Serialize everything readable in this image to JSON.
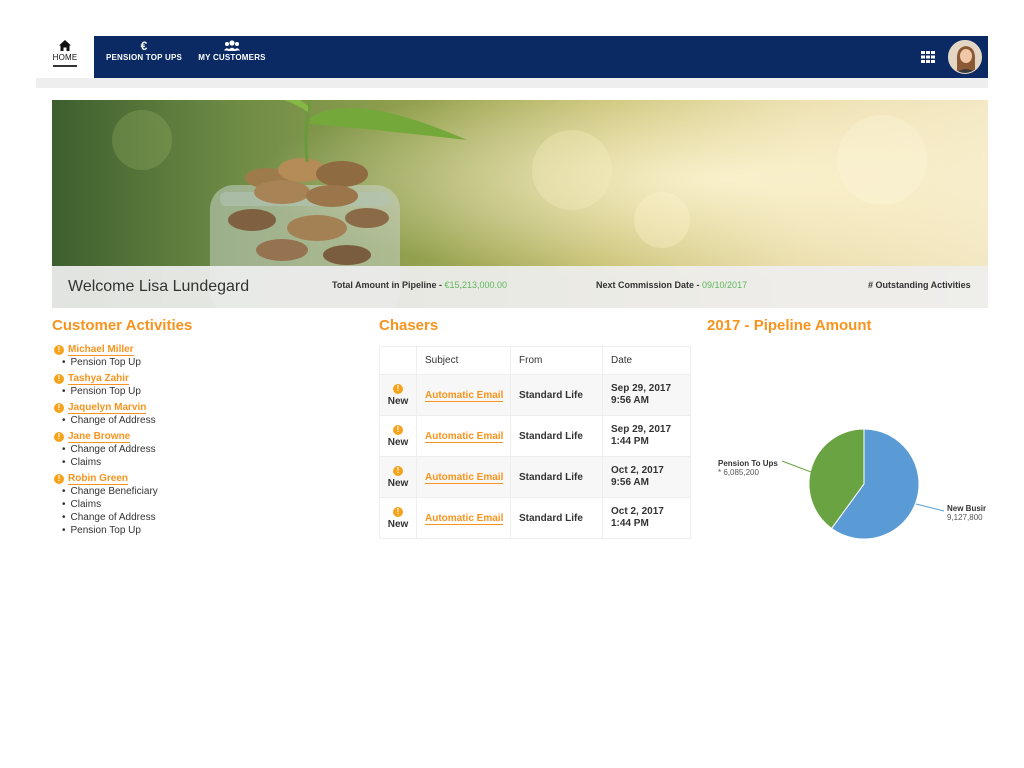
{
  "nav": {
    "home": "HOME",
    "pension_top_ups": "PENSION TOP UPS",
    "my_customers": "MY CUSTOMERS",
    "icons": {
      "home": "house-icon",
      "pension": "euro-icon",
      "customers": "users-icon",
      "apps": "grid-icon"
    }
  },
  "hero": {
    "welcome": "Welcome Lisa Lundegard",
    "total_label": "Total Amount in Pipeline - ",
    "total_value": "€15,213,000.00",
    "next_label": "Next Commission Date - ",
    "next_value": "09/10/2017",
    "outstanding_label": "# Outstanding Activities"
  },
  "activities": {
    "title": "Customer Activities",
    "customers": [
      {
        "name": "Michael Miller",
        "items": [
          "Pension Top Up"
        ]
      },
      {
        "name": "Tashya Zahir",
        "items": [
          "Pension Top Up"
        ]
      },
      {
        "name": "Jaquelyn Marvin",
        "items": [
          "Change of Address"
        ]
      },
      {
        "name": "Jane Browne",
        "items": [
          "Change of Address",
          "Claims"
        ]
      },
      {
        "name": "Robin Green",
        "items": [
          "Change Beneficiary",
          "Claims",
          "Change of Address",
          "Pension Top Up"
        ]
      }
    ]
  },
  "chasers": {
    "title": "Chasers",
    "headers": [
      "",
      "Subject",
      "From",
      "Date"
    ],
    "rows": [
      {
        "status": "New",
        "subject": "Automatic Email",
        "from": "Standard Life",
        "date1": "Sep 29, 2017",
        "date2": "9:56 AM"
      },
      {
        "status": "New",
        "subject": "Automatic Email",
        "from": "Standard Life",
        "date1": "Sep 29, 2017",
        "date2": "1:44 PM"
      },
      {
        "status": "New",
        "subject": "Automatic Email",
        "from": "Standard Life",
        "date1": "Oct 2, 2017",
        "date2": "9:56 AM"
      },
      {
        "status": "New",
        "subject": "Automatic Email",
        "from": "Standard Life",
        "date1": "Oct 2, 2017",
        "date2": "1:44 PM"
      }
    ]
  },
  "pipeline": {
    "title": "2017 - Pipeline Amount"
  },
  "chart_data": {
    "type": "pie",
    "title": "2017 - Pipeline Amount",
    "slices": [
      {
        "label": "New Busir",
        "value": 9127800,
        "value_text": "9,127,800",
        "color": "#5b9bd5"
      },
      {
        "label": "Pension To Ups",
        "value": 6085200,
        "value_text": "* 6,085,200",
        "color": "#6aa342"
      }
    ]
  },
  "colors": {
    "nav": "#0b2a63",
    "accent": "#f7941e",
    "positive": "#5cb85c"
  }
}
